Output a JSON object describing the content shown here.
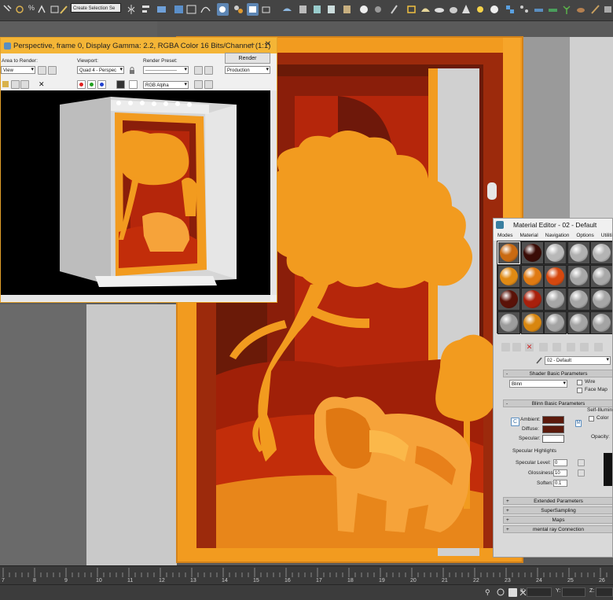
{
  "toolbar": {
    "selection_set_placeholder": "Create Selection Se",
    "percent_snap_label": "%"
  },
  "render_window": {
    "title": "Perspective, frame 0, Display Gamma: 2.2, RGBA Color 16 Bits/Channel (1:1)",
    "area_to_render_label": "Area to Render:",
    "area_to_render_value": "View",
    "viewport_label": "Viewport:",
    "viewport_value": "Quad 4 - Perspec",
    "render_preset_label": "Render Preset:",
    "render_preset_value": "--------------------",
    "render_button": "Render",
    "production_value": "Production",
    "channel_value": "RGB Alpha",
    "minimize": "–",
    "close": "✕"
  },
  "material_editor": {
    "title": "Material Editor - 02 - Default",
    "menu": [
      "Modes",
      "Material",
      "Navigation",
      "Options",
      "Utilities"
    ],
    "material_name": "02 - Default",
    "sample_spheres": [
      "#c96a12",
      "#3a0c06",
      "#b8b8b8",
      "#b0b0b0",
      "#b4b4b4",
      "#e08a14",
      "#e07a12",
      "#d5480f",
      "#a8a8a8",
      "#a8a8a8",
      "#5a1208",
      "#a8200c",
      "#a6a6a6",
      "#a6a6a6",
      "#a6a6a6",
      "#9c9c9c",
      "#d8860f",
      "#a4a4a4",
      "#a4a4a4",
      "#a4a4a4"
    ],
    "shader_rollout": "Shader Basic Parameters",
    "shader_value": "Blinn",
    "wire_label": "Wire",
    "face_map_label": "Face Map",
    "blinn_rollout": "Blinn Basic Parameters",
    "self_illum_label": "Self-Illumin",
    "color_label": "Color",
    "opacity_label": "Opacity:",
    "ambient_label": "Ambient:",
    "diffuse_label": "Diffuse:",
    "specular_label": "Specular:",
    "ambient_color": "#5c1a0c",
    "diffuse_color": "#5c1a0c",
    "specular_color": "#ffffff",
    "lock_label": "C",
    "map_button_label": "M",
    "specular_highlights_label": "Specular Highlights",
    "specular_level_label": "Specular Level:",
    "specular_level_value": "0",
    "glossiness_label": "Glossiness:",
    "glossiness_value": "10",
    "soften_label": "Soften:",
    "soften_value": "0.1",
    "extended_rollout": "Extended Parameters",
    "supersampling_rollout": "SuperSampling",
    "maps_rollout": "Maps",
    "mental_ray_rollout": "mental ray Connection"
  },
  "timeline": {
    "ticks": [
      "7",
      "8",
      "9",
      "10",
      "11",
      "12",
      "13",
      "14",
      "15",
      "16",
      "17",
      "18",
      "19",
      "20",
      "21",
      "22",
      "23",
      "24",
      "25",
      "26"
    ]
  },
  "status": {
    "x_label": "X:",
    "y_label": "Y:",
    "z_label": "Z:"
  },
  "colors": {
    "accent_orange": "#f29b1f",
    "title_bar": "#f4b536",
    "dark_red": "#7a1a0c",
    "deep_red": "#b5260b"
  }
}
